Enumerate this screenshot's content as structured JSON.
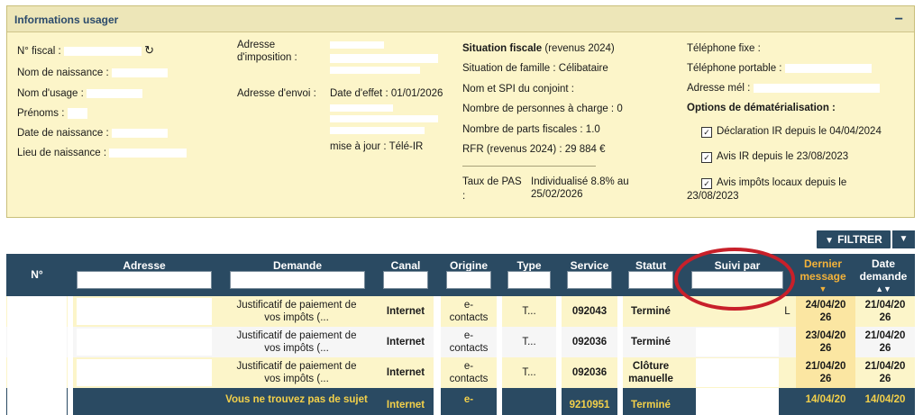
{
  "panel": {
    "title": "Informations usager",
    "collapse_glyph": "−",
    "col1": {
      "fiscal_label": "N° fiscal :",
      "birth_name_label": "Nom de naissance :",
      "usage_name_label": "Nom d'usage :",
      "first_names_label": "Prénoms :",
      "birth_date_label": "Date de naissance :",
      "birth_place_label": "Lieu de naissance :"
    },
    "col2": {
      "tax_address_label": "Adresse d'imposition :",
      "send_address_label": "Adresse d'envoi :",
      "effective_date": "Date d'effet : 01/01/2026",
      "update_label": "mise à jour : Télé-IR"
    },
    "col3": {
      "situation_title": "Situation fiscale",
      "situation_period": "(revenus 2024)",
      "family_status": "Situation de famille :",
      "family_value": "Célibataire",
      "spouse_label": "Nom et SPI du conjoint :",
      "dependents": "Nombre de personnes à charge :",
      "dependents_value": "0",
      "shares": "Nombre de parts fiscales :",
      "shares_value": "1.0",
      "rfr": "RFR (revenus 2024) :",
      "rfr_value": "29 884 €",
      "pas_label": "Taux de PAS",
      "pas_colon": ":",
      "pas_value_1": "Individualisé 8.8% au",
      "pas_value_2": "25/02/2026"
    },
    "col4": {
      "phone_fixed": "Téléphone fixe :",
      "phone_mobile": "Téléphone portable :",
      "email": "Adresse mél :",
      "dematerialization_title": "Options de dématérialisation :",
      "option_ir": "Déclaration IR depuis le 04/04/2024",
      "option_avis_ir": "Avis IR depuis le 23/08/2023",
      "option_avis_local_1": "Avis impôts locaux depuis le",
      "option_avis_local_2": "23/08/2023",
      "check_glyph": "✓"
    }
  },
  "toolbar": {
    "filter_label": "FILTRER",
    "filter_icon": "filter-icon",
    "dropdown_icon": "caret-down-icon"
  },
  "table": {
    "headers": {
      "num": "N°",
      "address": "Adresse",
      "request": "Demande",
      "channel": "Canal",
      "origin": "Origine",
      "type": "Type",
      "service": "Service",
      "status": "Statut",
      "followed_by": "Suivi par",
      "last_message_1": "Dernier",
      "last_message_2": "message",
      "request_date_1": "Date",
      "request_date_2": "demande"
    },
    "rows": [
      {
        "request_1": "Justificatif de paiement de",
        "request_2": "vos impôts (...",
        "channel": "Internet",
        "origin_1": "e-",
        "origin_2": "contacts",
        "type": "T...",
        "service": "092043",
        "status_1": "Terminé",
        "status_2": "",
        "followed": "L",
        "last_1": "24/04/20",
        "last_2": "26",
        "date_1": "21/04/20",
        "date_2": "26"
      },
      {
        "request_1": "Justificatif de paiement de",
        "request_2": "vos impôts (...",
        "channel": "Internet",
        "origin_1": "e-",
        "origin_2": "contacts",
        "type": "T...",
        "service": "092036",
        "status_1": "Terminé",
        "status_2": "",
        "followed": "",
        "last_1": "23/04/20",
        "last_2": "26",
        "date_1": "21/04/20",
        "date_2": "26"
      },
      {
        "request_1": "Justificatif de paiement de",
        "request_2": "vos impôts (...",
        "channel": "Internet",
        "origin_1": "e-",
        "origin_2": "contacts",
        "type": "T...",
        "service": "092036",
        "status_1": "Clôture",
        "status_2": "manuelle",
        "followed": "",
        "last_1": "21/04/20",
        "last_2": "26",
        "date_1": "21/04/20",
        "date_2": "26"
      },
      {
        "request_1": "Vous ne trouvez pas de sujet",
        "request_2": "",
        "channel": "Internet",
        "origin_1": "e-",
        "origin_2": "",
        "type": "",
        "service": "9210951",
        "status_1": "Terminé",
        "status_2": "",
        "followed": "",
        "last_1": "14/04/20",
        "last_2": "",
        "date_1": "14/04/20",
        "date_2": ""
      }
    ]
  }
}
